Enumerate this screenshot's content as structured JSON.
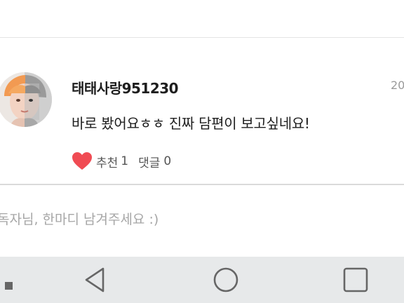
{
  "comment": {
    "nickname": "태태사랑951230",
    "date": "20",
    "text": "바로 봤어요ㅎㅎ 진짜 담편이 보고싶네요!",
    "like_label": "추천",
    "like_count": "1",
    "reply_label": "댓글",
    "reply_count": "0",
    "avatar_icon": "profile-photo",
    "heart_color": "#f04b53"
  },
  "input": {
    "placeholder": "독자님, 한마디 남겨주세요 :)",
    "value": ""
  },
  "nav_bar": {
    "buttons": [
      "back-icon",
      "home-icon",
      "recents-icon"
    ],
    "background": "#e7e9ea"
  }
}
